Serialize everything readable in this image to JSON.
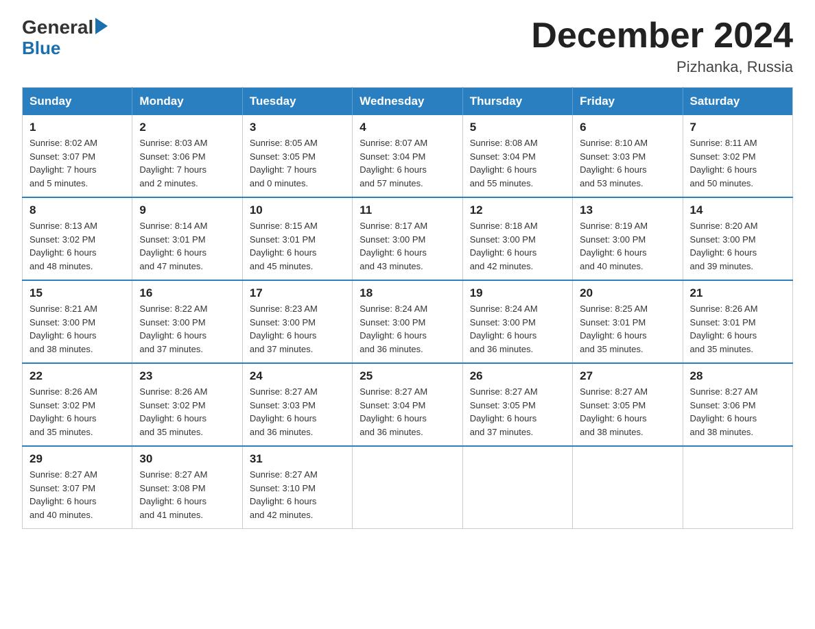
{
  "header": {
    "month_title": "December 2024",
    "location": "Pizhanka, Russia",
    "logo_general": "General",
    "logo_blue": "Blue"
  },
  "days_of_week": [
    "Sunday",
    "Monday",
    "Tuesday",
    "Wednesday",
    "Thursday",
    "Friday",
    "Saturday"
  ],
  "weeks": [
    [
      {
        "day": "1",
        "sunrise": "Sunrise: 8:02 AM",
        "sunset": "Sunset: 3:07 PM",
        "daylight": "Daylight: 7 hours",
        "daylight2": "and 5 minutes."
      },
      {
        "day": "2",
        "sunrise": "Sunrise: 8:03 AM",
        "sunset": "Sunset: 3:06 PM",
        "daylight": "Daylight: 7 hours",
        "daylight2": "and 2 minutes."
      },
      {
        "day": "3",
        "sunrise": "Sunrise: 8:05 AM",
        "sunset": "Sunset: 3:05 PM",
        "daylight": "Daylight: 7 hours",
        "daylight2": "and 0 minutes."
      },
      {
        "day": "4",
        "sunrise": "Sunrise: 8:07 AM",
        "sunset": "Sunset: 3:04 PM",
        "daylight": "Daylight: 6 hours",
        "daylight2": "and 57 minutes."
      },
      {
        "day": "5",
        "sunrise": "Sunrise: 8:08 AM",
        "sunset": "Sunset: 3:04 PM",
        "daylight": "Daylight: 6 hours",
        "daylight2": "and 55 minutes."
      },
      {
        "day": "6",
        "sunrise": "Sunrise: 8:10 AM",
        "sunset": "Sunset: 3:03 PM",
        "daylight": "Daylight: 6 hours",
        "daylight2": "and 53 minutes."
      },
      {
        "day": "7",
        "sunrise": "Sunrise: 8:11 AM",
        "sunset": "Sunset: 3:02 PM",
        "daylight": "Daylight: 6 hours",
        "daylight2": "and 50 minutes."
      }
    ],
    [
      {
        "day": "8",
        "sunrise": "Sunrise: 8:13 AM",
        "sunset": "Sunset: 3:02 PM",
        "daylight": "Daylight: 6 hours",
        "daylight2": "and 48 minutes."
      },
      {
        "day": "9",
        "sunrise": "Sunrise: 8:14 AM",
        "sunset": "Sunset: 3:01 PM",
        "daylight": "Daylight: 6 hours",
        "daylight2": "and 47 minutes."
      },
      {
        "day": "10",
        "sunrise": "Sunrise: 8:15 AM",
        "sunset": "Sunset: 3:01 PM",
        "daylight": "Daylight: 6 hours",
        "daylight2": "and 45 minutes."
      },
      {
        "day": "11",
        "sunrise": "Sunrise: 8:17 AM",
        "sunset": "Sunset: 3:00 PM",
        "daylight": "Daylight: 6 hours",
        "daylight2": "and 43 minutes."
      },
      {
        "day": "12",
        "sunrise": "Sunrise: 8:18 AM",
        "sunset": "Sunset: 3:00 PM",
        "daylight": "Daylight: 6 hours",
        "daylight2": "and 42 minutes."
      },
      {
        "day": "13",
        "sunrise": "Sunrise: 8:19 AM",
        "sunset": "Sunset: 3:00 PM",
        "daylight": "Daylight: 6 hours",
        "daylight2": "and 40 minutes."
      },
      {
        "day": "14",
        "sunrise": "Sunrise: 8:20 AM",
        "sunset": "Sunset: 3:00 PM",
        "daylight": "Daylight: 6 hours",
        "daylight2": "and 39 minutes."
      }
    ],
    [
      {
        "day": "15",
        "sunrise": "Sunrise: 8:21 AM",
        "sunset": "Sunset: 3:00 PM",
        "daylight": "Daylight: 6 hours",
        "daylight2": "and 38 minutes."
      },
      {
        "day": "16",
        "sunrise": "Sunrise: 8:22 AM",
        "sunset": "Sunset: 3:00 PM",
        "daylight": "Daylight: 6 hours",
        "daylight2": "and 37 minutes."
      },
      {
        "day": "17",
        "sunrise": "Sunrise: 8:23 AM",
        "sunset": "Sunset: 3:00 PM",
        "daylight": "Daylight: 6 hours",
        "daylight2": "and 37 minutes."
      },
      {
        "day": "18",
        "sunrise": "Sunrise: 8:24 AM",
        "sunset": "Sunset: 3:00 PM",
        "daylight": "Daylight: 6 hours",
        "daylight2": "and 36 minutes."
      },
      {
        "day": "19",
        "sunrise": "Sunrise: 8:24 AM",
        "sunset": "Sunset: 3:00 PM",
        "daylight": "Daylight: 6 hours",
        "daylight2": "and 36 minutes."
      },
      {
        "day": "20",
        "sunrise": "Sunrise: 8:25 AM",
        "sunset": "Sunset: 3:01 PM",
        "daylight": "Daylight: 6 hours",
        "daylight2": "and 35 minutes."
      },
      {
        "day": "21",
        "sunrise": "Sunrise: 8:26 AM",
        "sunset": "Sunset: 3:01 PM",
        "daylight": "Daylight: 6 hours",
        "daylight2": "and 35 minutes."
      }
    ],
    [
      {
        "day": "22",
        "sunrise": "Sunrise: 8:26 AM",
        "sunset": "Sunset: 3:02 PM",
        "daylight": "Daylight: 6 hours",
        "daylight2": "and 35 minutes."
      },
      {
        "day": "23",
        "sunrise": "Sunrise: 8:26 AM",
        "sunset": "Sunset: 3:02 PM",
        "daylight": "Daylight: 6 hours",
        "daylight2": "and 35 minutes."
      },
      {
        "day": "24",
        "sunrise": "Sunrise: 8:27 AM",
        "sunset": "Sunset: 3:03 PM",
        "daylight": "Daylight: 6 hours",
        "daylight2": "and 36 minutes."
      },
      {
        "day": "25",
        "sunrise": "Sunrise: 8:27 AM",
        "sunset": "Sunset: 3:04 PM",
        "daylight": "Daylight: 6 hours",
        "daylight2": "and 36 minutes."
      },
      {
        "day": "26",
        "sunrise": "Sunrise: 8:27 AM",
        "sunset": "Sunset: 3:05 PM",
        "daylight": "Daylight: 6 hours",
        "daylight2": "and 37 minutes."
      },
      {
        "day": "27",
        "sunrise": "Sunrise: 8:27 AM",
        "sunset": "Sunset: 3:05 PM",
        "daylight": "Daylight: 6 hours",
        "daylight2": "and 38 minutes."
      },
      {
        "day": "28",
        "sunrise": "Sunrise: 8:27 AM",
        "sunset": "Sunset: 3:06 PM",
        "daylight": "Daylight: 6 hours",
        "daylight2": "and 38 minutes."
      }
    ],
    [
      {
        "day": "29",
        "sunrise": "Sunrise: 8:27 AM",
        "sunset": "Sunset: 3:07 PM",
        "daylight": "Daylight: 6 hours",
        "daylight2": "and 40 minutes."
      },
      {
        "day": "30",
        "sunrise": "Sunrise: 8:27 AM",
        "sunset": "Sunset: 3:08 PM",
        "daylight": "Daylight: 6 hours",
        "daylight2": "and 41 minutes."
      },
      {
        "day": "31",
        "sunrise": "Sunrise: 8:27 AM",
        "sunset": "Sunset: 3:10 PM",
        "daylight": "Daylight: 6 hours",
        "daylight2": "and 42 minutes."
      },
      null,
      null,
      null,
      null
    ]
  ]
}
